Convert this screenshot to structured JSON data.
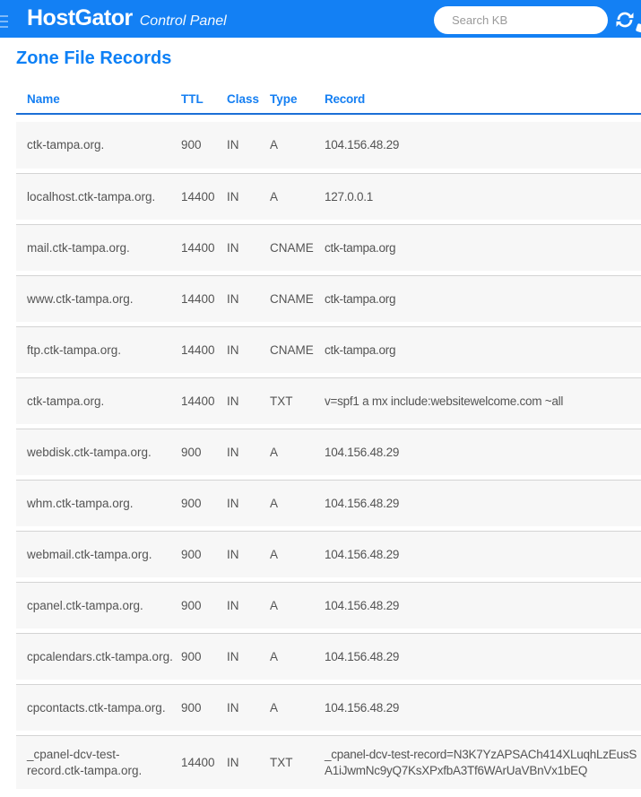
{
  "header": {
    "brand": "HostGator",
    "brand_suffix": "Control Panel",
    "search_placeholder": "Search KB",
    "colors": {
      "bar": "#1380f4",
      "accent": "#0d80f6"
    }
  },
  "page": {
    "title": "Zone File Records"
  },
  "table": {
    "columns": [
      "Name",
      "TTL",
      "Class",
      "Type",
      "Record"
    ],
    "rows": [
      {
        "name": "ctk-tampa.org.",
        "ttl": "900",
        "class": "IN",
        "type": "A",
        "record": "104.156.48.29"
      },
      {
        "name": "localhost.ctk-tampa.org.",
        "ttl": "14400",
        "class": "IN",
        "type": "A",
        "record": "127.0.0.1"
      },
      {
        "name": "mail.ctk-tampa.org.",
        "ttl": "14400",
        "class": "IN",
        "type": "CNAME",
        "record": "ctk-tampa.org"
      },
      {
        "name": "www.ctk-tampa.org.",
        "ttl": "14400",
        "class": "IN",
        "type": "CNAME",
        "record": "ctk-tampa.org"
      },
      {
        "name": "ftp.ctk-tampa.org.",
        "ttl": "14400",
        "class": "IN",
        "type": "CNAME",
        "record": "ctk-tampa.org"
      },
      {
        "name": "ctk-tampa.org.",
        "ttl": "14400",
        "class": "IN",
        "type": "TXT",
        "record": "v=spf1 a mx include:websitewelcome.com ~all"
      },
      {
        "name": "webdisk.ctk-tampa.org.",
        "ttl": "900",
        "class": "IN",
        "type": "A",
        "record": "104.156.48.29"
      },
      {
        "name": "whm.ctk-tampa.org.",
        "ttl": "900",
        "class": "IN",
        "type": "A",
        "record": "104.156.48.29"
      },
      {
        "name": "webmail.ctk-tampa.org.",
        "ttl": "900",
        "class": "IN",
        "type": "A",
        "record": "104.156.48.29"
      },
      {
        "name": "cpanel.ctk-tampa.org.",
        "ttl": "900",
        "class": "IN",
        "type": "A",
        "record": "104.156.48.29"
      },
      {
        "name": "cpcalendars.ctk-tampa.org.",
        "ttl": "900",
        "class": "IN",
        "type": "A",
        "record": "104.156.48.29"
      },
      {
        "name": "cpcontacts.ctk-tampa.org.",
        "ttl": "900",
        "class": "IN",
        "type": "A",
        "record": "104.156.48.29"
      },
      {
        "name": "_cpanel-dcv-test-record.ctk-tampa.org.",
        "ttl": "14400",
        "class": "IN",
        "type": "TXT",
        "record": "_cpanel-dcv-test-record=N3K7YzAPSACh414XLuqhLzEusSA1iJwmNc9yQ7KsXPxfbA3Tf6WArUaVBnVx1bEQ"
      }
    ]
  }
}
